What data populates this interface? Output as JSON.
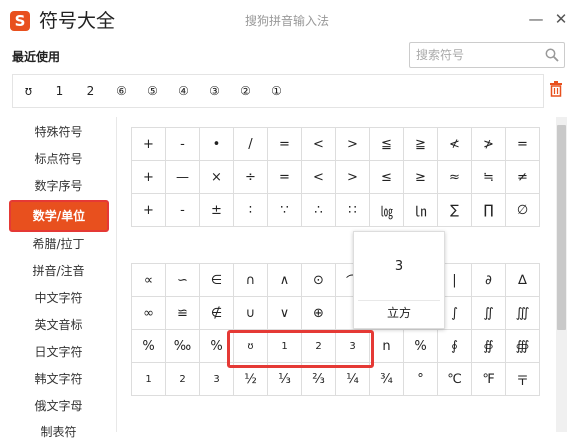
{
  "app": {
    "title": "符号大全",
    "subtitle": "搜狗拼音输入法",
    "logo_letter": "S"
  },
  "window": {
    "minimize_label": "—",
    "close_label": "✕"
  },
  "search": {
    "placeholder": "搜索符号"
  },
  "recent": {
    "label": "最近使用",
    "items": [
      "ʊ",
      "1",
      "2",
      "⑥",
      "⑤",
      "④",
      "③",
      "②",
      "①",
      "",
      "",
      "",
      "",
      "",
      "",
      "",
      ""
    ]
  },
  "sidebar": {
    "items": [
      {
        "label": "特殊符号"
      },
      {
        "label": "标点符号"
      },
      {
        "label": "数字序号"
      },
      {
        "label": "数学/单位",
        "active": true
      },
      {
        "label": "希腊/拉丁"
      },
      {
        "label": "拼音/注音"
      },
      {
        "label": "中文字符"
      },
      {
        "label": "英文音标"
      },
      {
        "label": "日文字符"
      },
      {
        "label": "韩文字符"
      },
      {
        "label": "俄文字母"
      },
      {
        "label": "制表符"
      }
    ]
  },
  "grid1": [
    [
      "+",
      "-",
      "•",
      "/",
      "=",
      "<",
      ">",
      "≦",
      "≧",
      "≮",
      "≯",
      "="
    ],
    [
      "+",
      "—",
      "×",
      "÷",
      "=",
      "<",
      ">",
      "≤",
      "≥",
      "≈",
      "≒",
      "≠"
    ],
    [
      "+",
      "-",
      "±",
      "∶",
      "∵",
      "∴",
      "∷",
      "㏒",
      "㏑",
      "∑",
      "∏",
      "∅"
    ]
  ],
  "grid2": [
    [
      "∝",
      "∽",
      "∈",
      "∩",
      "∧",
      "⊙",
      "⌒",
      "",
      "",
      "|",
      "∂",
      "∆"
    ],
    [
      "∞",
      "≌",
      "∉",
      "∪",
      "∨",
      "⊕",
      "",
      "",
      "",
      "∫",
      "∬",
      "∭"
    ],
    [
      "%",
      "‰",
      "%",
      "ʊ",
      "1",
      "2",
      "3",
      "n",
      "%",
      "∮",
      "∯",
      "∰"
    ],
    [
      "1",
      "2",
      "3",
      "½",
      "⅓",
      "⅔",
      "¼",
      "¾",
      "°",
      "℃",
      "℉",
      "〒"
    ]
  ],
  "popup": {
    "char": "3",
    "name": "立方"
  },
  "colors": {
    "accent": "#e8501e",
    "highlight": "#e53935"
  }
}
